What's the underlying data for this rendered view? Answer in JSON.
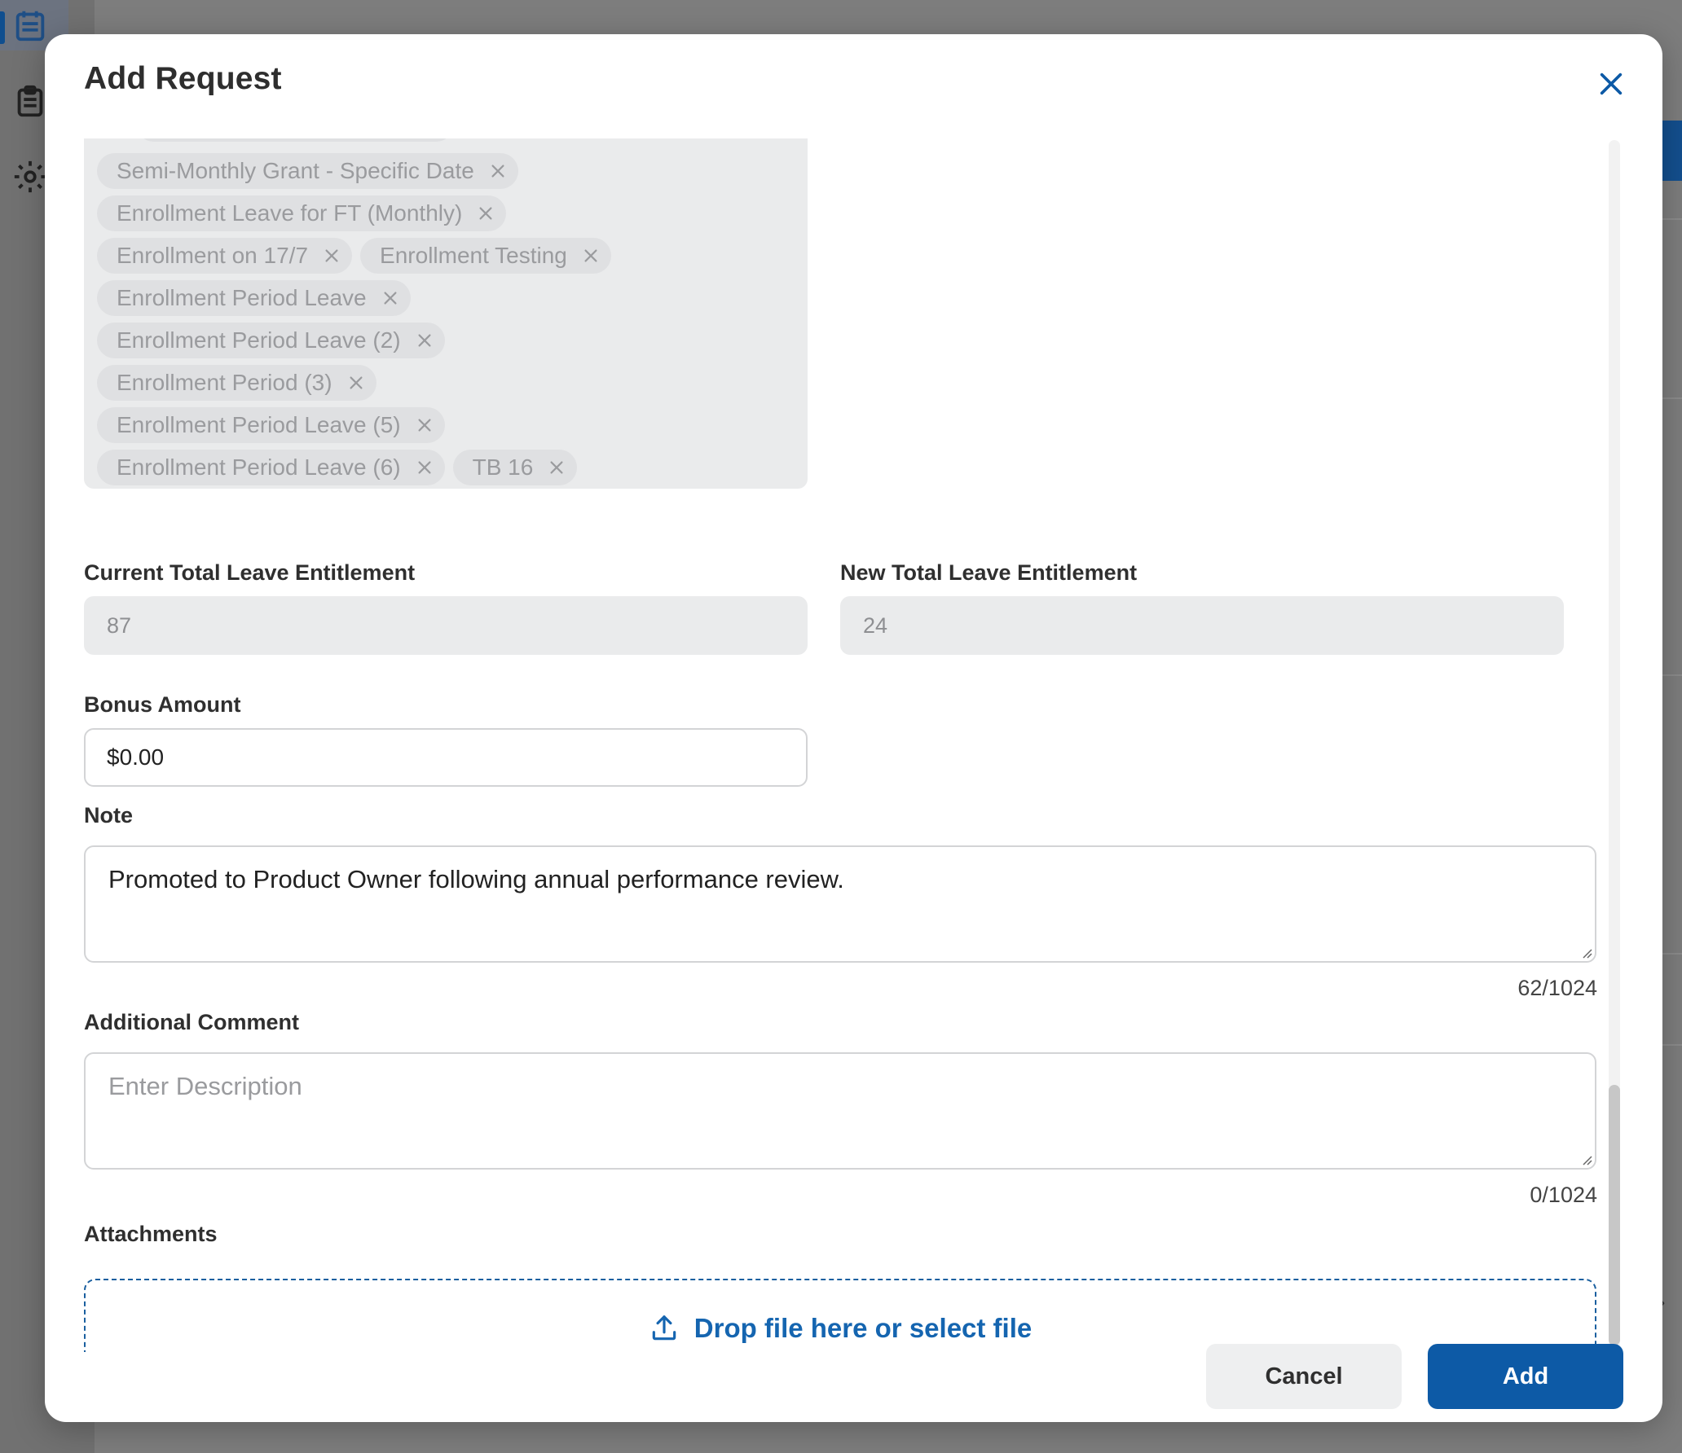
{
  "modal": {
    "title": "Add Request",
    "close_icon": "close-icon"
  },
  "leave_types": {
    "rows": [
      [
        {
          "label": "Semi-Monthly Grant - Specific Date"
        }
      ],
      [
        {
          "label": "Enrollment Leave for FT (Monthly)"
        }
      ],
      [
        {
          "label": "Enrollment on 17/7"
        },
        {
          "label": "Enrollment Testing"
        }
      ],
      [
        {
          "label": "Enrollment Period Leave"
        }
      ],
      [
        {
          "label": "Enrollment Period Leave (2)"
        }
      ],
      [
        {
          "label": "Enrollment Period (3)"
        }
      ],
      [
        {
          "label": "Enrollment Period Leave (5)"
        }
      ],
      [
        {
          "label": "Enrollment Period Leave (6)"
        },
        {
          "label": "TB 16"
        }
      ]
    ]
  },
  "fields": {
    "current_total_label": "Current Total Leave Entitlement",
    "current_total_value": "87",
    "new_total_label": "New Total Leave Entitlement",
    "new_total_value": "24",
    "bonus_label": "Bonus Amount",
    "bonus_value": "$0.00",
    "note_label": "Note",
    "note_value": "Promoted to Product Owner following annual performance review.",
    "note_counter": "62/1024",
    "comment_label": "Additional Comment",
    "comment_placeholder": "Enter Description",
    "comment_counter": "0/1024",
    "attachments_label": "Attachments",
    "dropzone_text": "Drop file here or select file",
    "dropzone_icon": "upload-icon"
  },
  "footer": {
    "cancel_label": "Cancel",
    "add_label": "Add"
  },
  "colors": {
    "accent": "#0d5aa6",
    "link": "#1565b0",
    "chip_bg": "#dfe0e2",
    "field_bg": "#eaebec"
  },
  "background_nav": {
    "icons": [
      "calendar-icon",
      "clipboard-icon",
      "gear-icon"
    ]
  }
}
